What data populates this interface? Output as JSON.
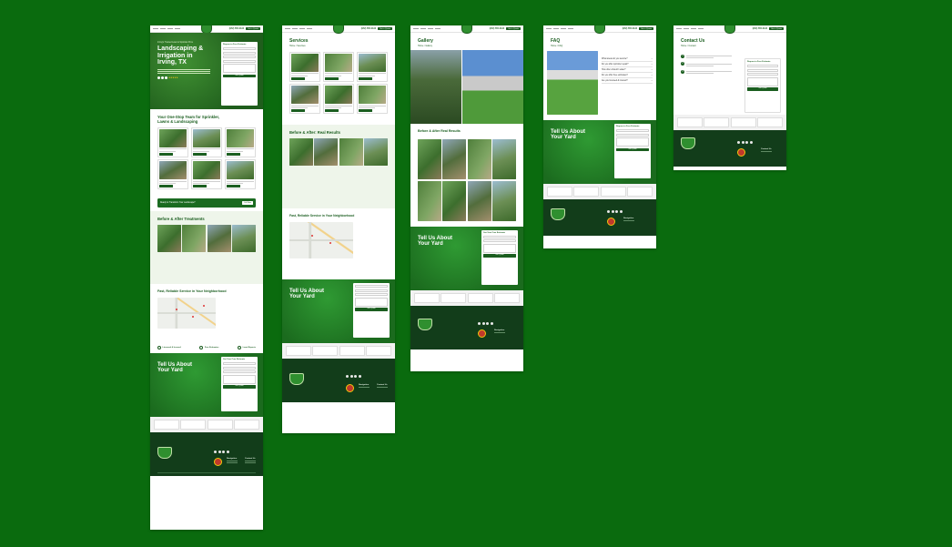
{
  "header": {
    "phone": "(972) 555-0134",
    "cta": "Get a Quote"
  },
  "home": {
    "hero_kicker": "Irving's Trusted Lawn & Sprinkler Pros",
    "hero_title": "Landscaping & Irrigation in Irving, TX",
    "stars": "★★★★★",
    "form_title": "Request a Free Estimate",
    "form_button": "Get Quote",
    "services_title": "Your One-Stop Team for Sprinkler, Lawns & Landscaping",
    "banner_text": "Ready to Transform Your Landscape?",
    "banner_btn": "Call Now",
    "before_after_title": "Before & After Treatments",
    "service_area_title": "Fast, Reliable Service in Your Neighborhood",
    "icons": [
      "Licensed & Insured",
      "Free Estimates",
      "Local Experts"
    ],
    "tell_us_title": "Tell Us About Your Yard",
    "tell_form_title": "Get Your Free Estimate",
    "tell_form_button": "Get Quote"
  },
  "services": {
    "title": "Services",
    "crumb_home": "Home",
    "crumb_current": "Services",
    "before_after_title": "Before & After: Real Results",
    "area_title": "Fast, Reliable Service in Your Neighborhood",
    "tell_us_title": "Tell Us About Your Yard",
    "form_button": "Get Quote"
  },
  "gallery": {
    "title": "Gallery",
    "crumb_home": "Home",
    "crumb_current": "Gallery",
    "before_after_title": "Before & After Real Results",
    "tell_us_title": "Tell Us About Your Yard",
    "form_title": "Get Your Free Estimate",
    "form_button": "Get Quote"
  },
  "faq": {
    "title": "FAQ",
    "crumb_home": "Home",
    "crumb_current": "FAQ",
    "questions": [
      "What areas do you service?",
      "Do you offer sprinkler repair?",
      "How often should I water?",
      "Do you offer free estimates?",
      "Are you licensed & insured?"
    ],
    "tell_us_title": "Tell Us About Your Yard",
    "form_title": "Request a Free Estimate",
    "form_button": "Get Quote"
  },
  "contact": {
    "title": "Contact Us",
    "crumb_home": "Home",
    "crumb_current": "Contact",
    "steps": [
      "1",
      "2",
      "3"
    ],
    "form_title": "Request a Free Estimate",
    "form_button": "Get Quote"
  },
  "footer": {
    "col1": "Navigation",
    "col2": "Contact Us"
  },
  "colors": {
    "background": "#0a6b0e",
    "brand_dark": "#1b5e20",
    "footer": "#123d1a"
  }
}
